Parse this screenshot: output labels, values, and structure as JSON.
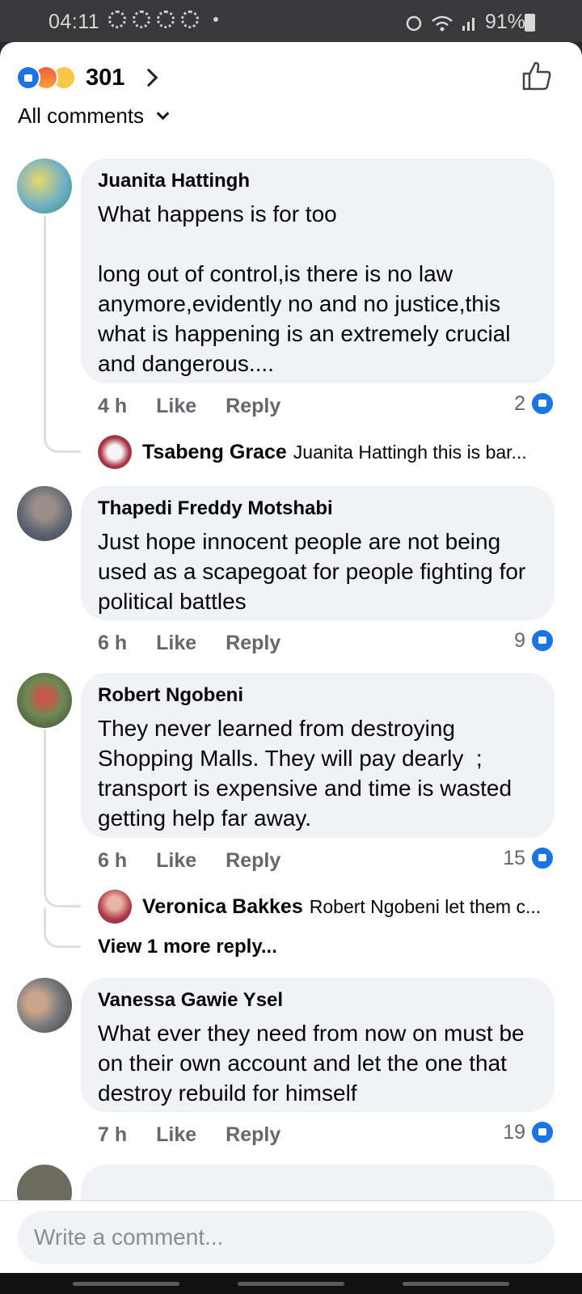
{
  "status_bar": {
    "time": "04:11",
    "battery": "91%"
  },
  "header": {
    "reaction_count": "301",
    "filter_label": "All comments"
  },
  "comments": [
    {
      "author": "Juanita Hattingh",
      "text": "What happens is for too\n\nlong out of control,is there is no law anymore,evidently no and no justice,this what is happening is an extremely crucial and dangerous....",
      "time": "4 h",
      "like_label": "Like",
      "reply_label": "Reply",
      "likes": "2",
      "replies": [
        {
          "author": "Tsabeng Grace",
          "preview": "Juanita Hattingh this is bar..."
        }
      ]
    },
    {
      "author": "Thapedi Freddy Motshabi",
      "text": "Just hope innocent people are not being used as a scapegoat for people fighting for political battles",
      "time": "6 h",
      "like_label": "Like",
      "reply_label": "Reply",
      "likes": "9"
    },
    {
      "author": "Robert Ngobeni",
      "text": "They never learned from destroying Shopping Malls. They will pay dearly  ; transport is expensive and time is wasted getting help far away.",
      "time": "6 h",
      "like_label": "Like",
      "reply_label": "Reply",
      "likes": "15",
      "replies": [
        {
          "author": "Veronica Bakkes",
          "preview": "Robert Ngobeni let them c..."
        }
      ],
      "view_more": "View 1 more reply..."
    },
    {
      "author": "Vanessa Gawie Ysel",
      "text": "What ever they need from now on must be on their own account and let the one that destroy rebuild for himself",
      "time": "7 h",
      "like_label": "Like",
      "reply_label": "Reply",
      "likes": "19"
    }
  ],
  "composer": {
    "placeholder": "Write a comment..."
  },
  "icons": {
    "reactions": [
      "like-reaction-icon",
      "angry-reaction-icon",
      "sad-reaction-icon"
    ],
    "like_color": "#1b74e4"
  }
}
